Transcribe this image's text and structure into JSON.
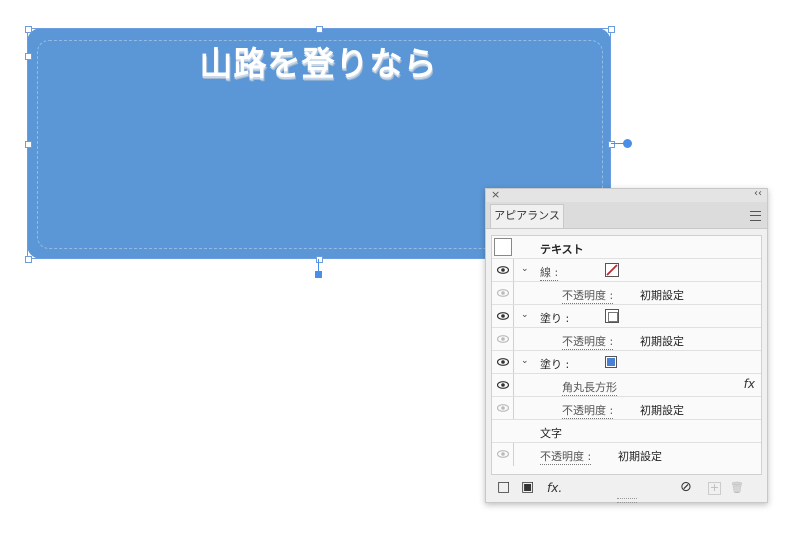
{
  "artboard": {
    "shape_text": "山路を登りなら",
    "fill_color": "#5b97d6",
    "accent_color": "#4a8fe6"
  },
  "panel": {
    "close_icon": "×",
    "collapse_icon": "‹‹",
    "tab_label": "アピアランス",
    "menu_icon": "panel-menu-icon",
    "rows": {
      "object_label": "テキスト",
      "stroke_label": "線 :",
      "stroke_opacity_label": "不透明度 :",
      "stroke_opacity_value": "初期設定",
      "fill1_label": "塗り :",
      "fill1_opacity_label": "不透明度 :",
      "fill1_opacity_value": "初期設定",
      "fill2_label": "塗り :",
      "effect_label": "角丸長方形",
      "effect_fx": "fx",
      "fill2_opacity_label": "不透明度 :",
      "fill2_opacity_value": "初期設定",
      "characters_label": "文字",
      "char_opacity_label": "不透明度 :",
      "char_opacity_value": "初期設定"
    },
    "toolbar": {
      "add_stroke": "□",
      "add_fill": "▣",
      "fx": "fx.",
      "clear": "⊘",
      "duplicate": "+",
      "delete": "🗑"
    },
    "fill2_color": "#4a7fd3",
    "stroke_color": "#c0282d"
  }
}
